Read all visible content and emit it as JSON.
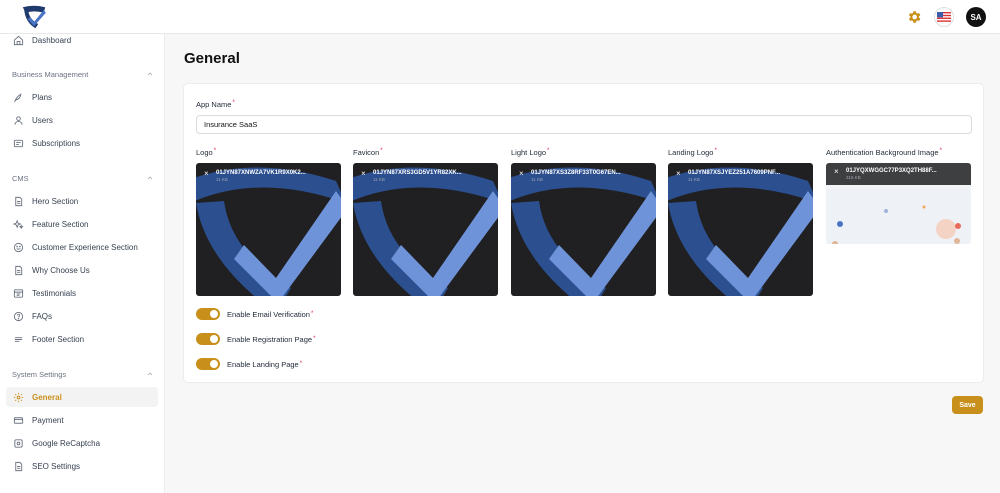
{
  "sidebar": {
    "dashboard": "Dashboard",
    "sections": [
      {
        "title": "Business Management",
        "items": [
          "Plans",
          "Users",
          "Subscriptions"
        ]
      },
      {
        "title": "CMS",
        "items": [
          "Hero Section",
          "Feature Section",
          "Customer Experience Section",
          "Why Choose Us",
          "Testimonials",
          "FAQs",
          "Footer Section"
        ]
      },
      {
        "title": "System Settings",
        "items": [
          "General",
          "Payment",
          "Google ReCaptcha",
          "SEO Settings"
        ]
      }
    ]
  },
  "header": {
    "avatar_initials": "SA"
  },
  "page": {
    "title": "General",
    "app_name_label": "App Name",
    "app_name_value": "Insurance SaaS",
    "images": [
      {
        "label": "Logo",
        "file_name": "01JYN87XNWZA7VK1R9X0K2...",
        "file_size": "11 KB"
      },
      {
        "label": "Favicon",
        "file_name": "01JYN87XRS3GD5V1YR82XK...",
        "file_size": "11 KB"
      },
      {
        "label": "Light Logo",
        "file_name": "01JYN87XS3Z8RF33T0G67EN...",
        "file_size": "11 KB"
      },
      {
        "label": "Landing Logo",
        "file_name": "01JYN87XSJYEZ251A7609PNF...",
        "file_size": "11 KB"
      },
      {
        "label": "Authentication Background Image",
        "file_name": "01JYQXWGGC77P3XQ2TH88F...",
        "file_size": "316 KB"
      }
    ],
    "toggles": [
      {
        "label": "Enable Email Verification",
        "on": true
      },
      {
        "label": "Enable Registration Page",
        "on": true
      },
      {
        "label": "Enable Landing Page",
        "on": true
      }
    ],
    "save_label": "Save"
  },
  "colors": {
    "accent": "#c8901a",
    "logo_blue": "#2c4f8f",
    "logo_light_blue": "#6f93d9"
  }
}
